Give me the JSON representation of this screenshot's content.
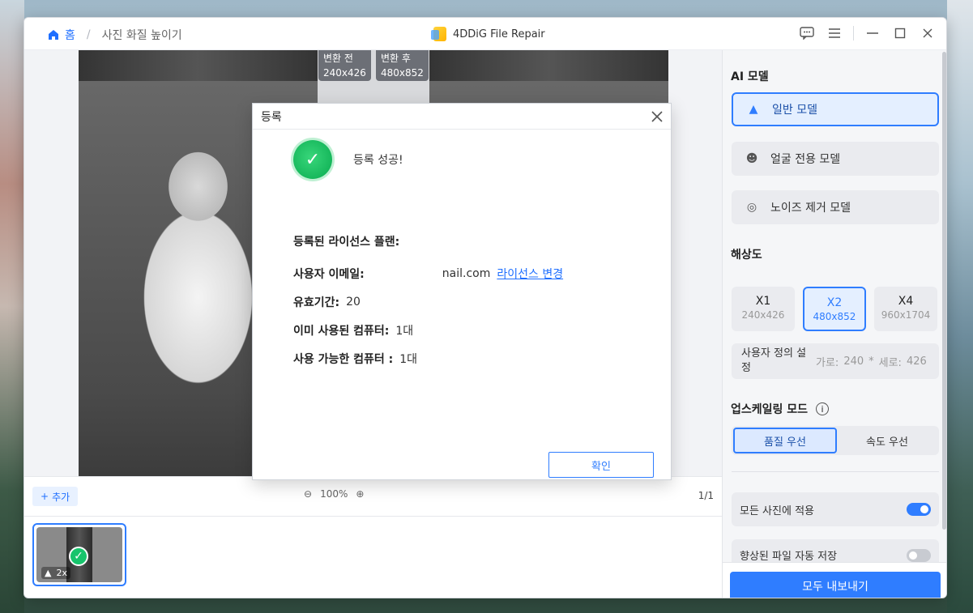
{
  "breadcrumb": {
    "home": "홈",
    "page": "사진 화질 높이기"
  },
  "app_title": "4DDiG File Repair",
  "compare": {
    "before_label": "변환 전",
    "before_size": "240x426",
    "after_label": "변환 후",
    "after_size": "480x852"
  },
  "controls": {
    "add_label": "추가",
    "zoom": "100%",
    "pager": "1/1"
  },
  "thumbnail": {
    "scale": "2x"
  },
  "sidebar": {
    "ai_model_title": "AI 모델",
    "models": [
      {
        "label": "일반 모델",
        "icon": "landscape-icon",
        "active": true
      },
      {
        "label": "얼굴 전용 모델",
        "icon": "face-icon",
        "active": false
      },
      {
        "label": "노이즈 제거 모델",
        "icon": "noise-icon",
        "active": false
      }
    ],
    "resolution_title": "해상도",
    "resolutions": [
      {
        "label": "X1",
        "size": "240x426",
        "active": false
      },
      {
        "label": "X2",
        "size": "480x852",
        "active": true
      },
      {
        "label": "X4",
        "size": "960x1704",
        "active": false
      }
    ],
    "custom": {
      "label": "사용자 정의 설정",
      "width_label": "가로:",
      "width": "240",
      "height_label": "세로:",
      "height": "426"
    },
    "upscale_title": "업스케일링 모드",
    "modes": [
      {
        "label": "품질 우선",
        "active": true
      },
      {
        "label": "속도 우선",
        "active": false
      }
    ],
    "apply_all": {
      "label": "모든 사진에 적용",
      "on": true
    },
    "auto_save": {
      "label": "향상된 파일 자동 저장",
      "on": false
    },
    "export_label": "모두 내보내기"
  },
  "dialog": {
    "title": "등록",
    "success": "등록 성공!",
    "plan_label": "등록된 라이선스 플랜:",
    "email_label": "사용자 이메일:",
    "email_value": "nail.com",
    "change_license": "라이선스 변경",
    "validity_label": "유효기간:",
    "validity_value": "20",
    "used_label": "이미 사용된 컴퓨터:",
    "used_value": "1대",
    "available_label": "사용 가능한 컴퓨터 :",
    "available_value": "1대",
    "ok_label": "확인"
  },
  "colors": {
    "accent": "#2f7dff",
    "success": "#17b85c"
  }
}
